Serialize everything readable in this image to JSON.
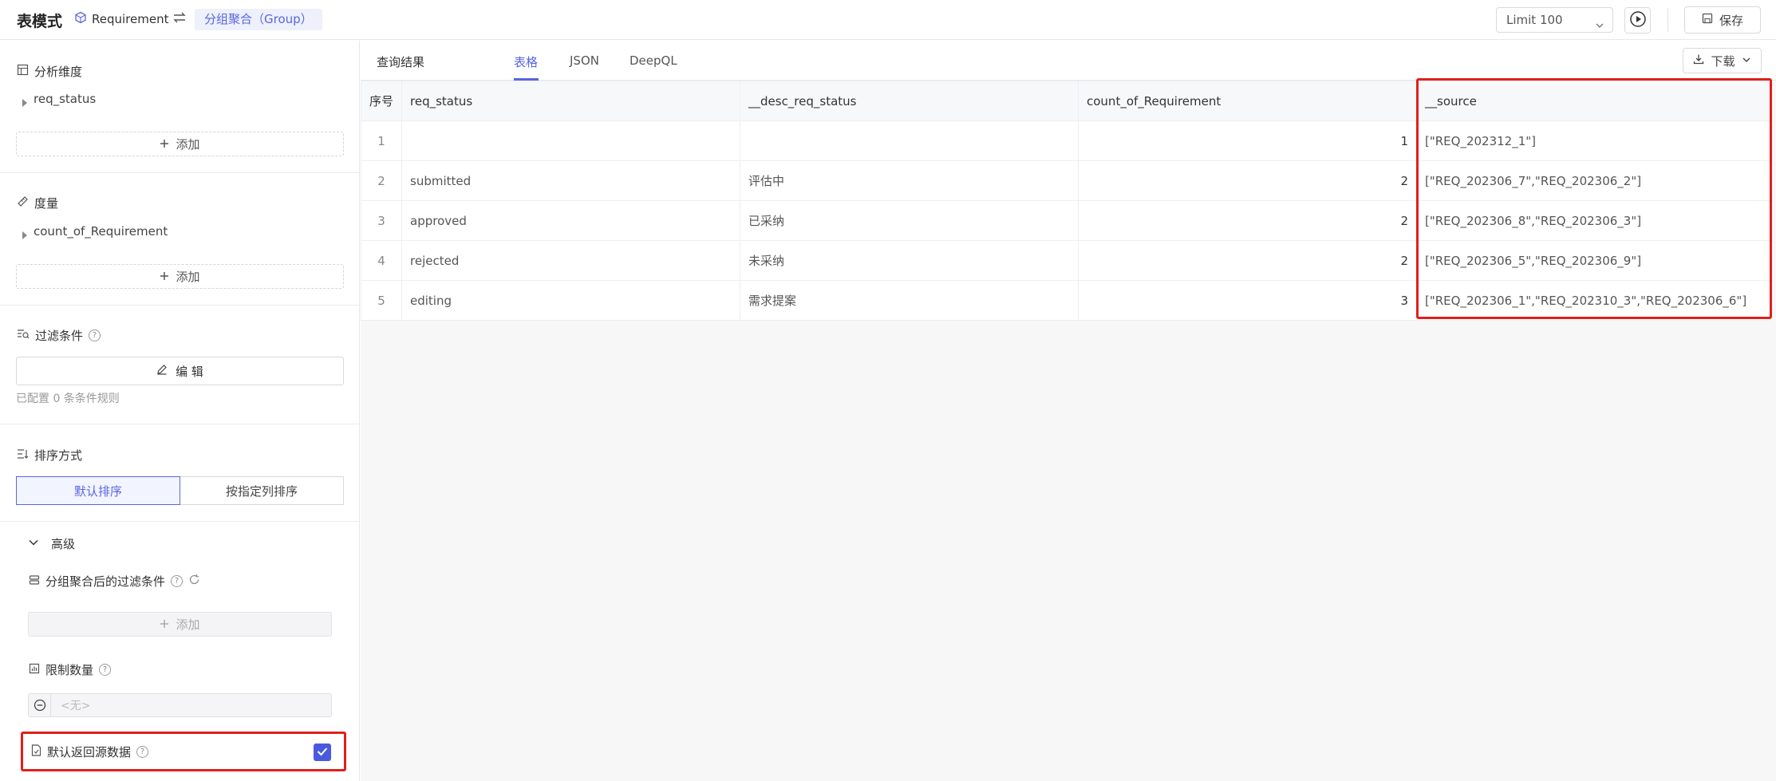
{
  "header": {
    "title": "表模式",
    "entity": "Requirement",
    "group_mode": "分组聚合（Group）",
    "limit": "Limit 100",
    "save_label": "保存"
  },
  "left": {
    "dimensions": {
      "title": "分析维度",
      "items": [
        "req_status"
      ],
      "add_label": "添加"
    },
    "measures": {
      "title": "度量",
      "items": [
        "count_of_Requirement"
      ],
      "add_label": "添加"
    },
    "filter": {
      "title": "过滤条件",
      "edit_label": "编 辑",
      "hint": "已配置 0 条条件规则"
    },
    "sort": {
      "title": "排序方式",
      "default_label": "默认排序",
      "column_label": "按指定列排序"
    },
    "advanced": {
      "title": "高级",
      "post_filter_title": "分组聚合后的过滤条件",
      "post_filter_add": "添加",
      "limit_title": "限制数量",
      "limit_placeholder": "<无>",
      "source_title": "默认返回源数据",
      "source_checked": true
    }
  },
  "results": {
    "title": "查询结果",
    "tabs": [
      "表格",
      "JSON",
      "DeepQL"
    ],
    "active_tab": "表格",
    "download_label": "下载",
    "columns": [
      "序号",
      "req_status",
      "__desc_req_status",
      "count_of_Requirement",
      "__source"
    ],
    "rows": [
      [
        "1",
        "",
        "",
        "1",
        "[\"REQ_202312_1\"]"
      ],
      [
        "2",
        "submitted",
        "评估中",
        "2",
        "[\"REQ_202306_7\",\"REQ_202306_2\"]"
      ],
      [
        "3",
        "approved",
        "已采纳",
        "2",
        "[\"REQ_202306_8\",\"REQ_202306_3\"]"
      ],
      [
        "4",
        "rejected",
        "未采纳",
        "2",
        "[\"REQ_202306_5\",\"REQ_202306_9\"]"
      ],
      [
        "5",
        "editing",
        "需求提案",
        "3",
        "[\"REQ_202306_1\",\"REQ_202310_3\",\"REQ_202306_6\"]"
      ]
    ]
  },
  "colors": {
    "accent": "#5866e0",
    "highlight": "#e0201a"
  }
}
